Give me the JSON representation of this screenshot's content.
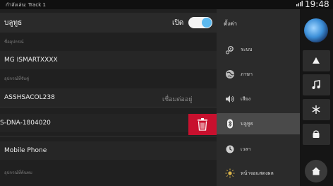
{
  "status_bar": {
    "now_playing": "กำลังเล่น: Track 1",
    "signal_icon": "signal-bars-icon",
    "time": "19:48"
  },
  "bluetooth": {
    "title": "บลูทูธ",
    "toggle_state_label": "เปิด",
    "toggle_on": true,
    "device_name_section_label": "ชื่ออุปกรณ์",
    "device_name": "MG ISMARTXXXX",
    "paired_devices_section_label": "อุปกรณ์ที่จับคู่",
    "paired_devices": [
      {
        "name": "ASSHSACOL238",
        "status": "เชื่อมต่ออยู่"
      },
      {
        "name": "S-DNA-1804020",
        "status": ""
      },
      {
        "name": "Mobile Phone",
        "status": ""
      }
    ],
    "available_devices_section_label": "อุปกรณ์ที่ค้นพบ",
    "delete_icon": "trash-icon"
  },
  "settings_menu": {
    "title": "ตั้งค่า",
    "items": [
      {
        "label": "ระบบ",
        "icon": "gear-icon",
        "active": false
      },
      {
        "label": "ภาษา",
        "icon": "globe-icon",
        "active": false
      },
      {
        "label": "เสียง",
        "icon": "speaker-icon",
        "active": false
      },
      {
        "label": "บลูทูธ",
        "icon": "bluetooth-icon",
        "active": true
      },
      {
        "label": "เวลา",
        "icon": "clock-icon",
        "active": false
      },
      {
        "label": "หน้าจอแสดงผล",
        "icon": "brightness-icon",
        "active": false
      }
    ]
  },
  "right_rail": {
    "logo": "mg-orb-logo",
    "buttons": [
      "navigation-arrow-icon",
      "music-note-icon",
      "fan-icon",
      "car-icon"
    ],
    "home": "home-icon"
  },
  "colors": {
    "accent_blue": "#5cb9ef",
    "delete_red": "#c8102e",
    "active_menu": "#4a4a4a"
  }
}
